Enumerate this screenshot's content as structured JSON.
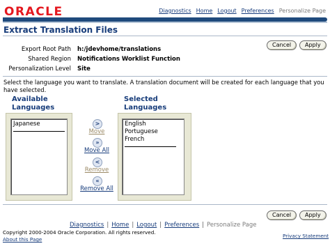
{
  "header": {
    "logo_text": "ORACLE",
    "links": [
      "Diagnostics",
      "Home",
      "Logout",
      "Preferences"
    ],
    "disabled_link": "Personalize Page"
  },
  "page": {
    "title": "Extract Translation Files",
    "cancel_label": "Cancel",
    "apply_label": "Apply"
  },
  "fields": [
    {
      "label": "Export Root Path",
      "value": "h:/jdevhome/translations"
    },
    {
      "label": "Shared Region",
      "value": "Notifications Worklist Function"
    },
    {
      "label": "Personalization Level",
      "value": "Site"
    }
  ],
  "instruction": "Select the language you want to translate. A translation document will be created for each language that you have selected.",
  "shuttle": {
    "available_heading_1": "Available",
    "available_heading_2": "Languages",
    "selected_heading_1": "Selected",
    "selected_heading_2": "Languages",
    "available_items": [
      "Japanese"
    ],
    "selected_items": [
      "English",
      "Portuguese",
      "French"
    ],
    "move_label": "Move",
    "move_all_label": "Move All",
    "remove_label": "Remove",
    "remove_all_label": "Remove All"
  },
  "footer": {
    "links": [
      "Diagnostics",
      "Home",
      "Logout",
      "Preferences"
    ],
    "disabled_link": "Personalize Page",
    "copyright": "Copyright 2000-2004 Oracle Corporation. All rights reserved.",
    "about": "About this Page",
    "privacy": "Privacy Statement"
  },
  "colors": {
    "brand_red": "#e4181f",
    "header_blue": "#1f4a7c",
    "title_blue": "#173c7a",
    "shuttle_bg": "#e8e8d5"
  }
}
